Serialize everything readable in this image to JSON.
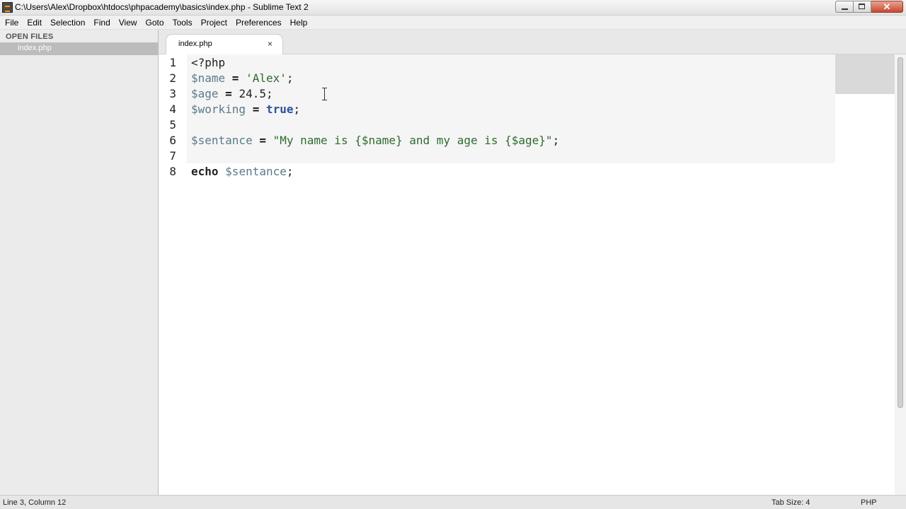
{
  "window": {
    "title": "C:\\Users\\Alex\\Dropbox\\htdocs\\phpacademy\\basics\\index.php - Sublime Text 2",
    "close_glyph": "✕"
  },
  "menu": [
    "File",
    "Edit",
    "Selection",
    "Find",
    "View",
    "Goto",
    "Tools",
    "Project",
    "Preferences",
    "Help"
  ],
  "sidebar": {
    "heading": "OPEN FILES",
    "files": [
      "index.php"
    ]
  },
  "tabs": [
    {
      "label": "index.php",
      "close": "×"
    }
  ],
  "editor": {
    "line_numbers": [
      "1",
      "2",
      "3",
      "4",
      "5",
      "6",
      "7",
      "8"
    ],
    "lines": {
      "l1": {
        "a": "<?php"
      },
      "l2": {
        "var": "$name",
        "op": " = ",
        "str": "'Alex'",
        "end": ";"
      },
      "l3": {
        "var": "$age",
        "op": " = ",
        "num": "24.5",
        "end": ";"
      },
      "l4": {
        "var": "$working",
        "op": " = ",
        "kw": "true",
        "end": ";"
      },
      "l6": {
        "var": "$sentance",
        "op": " = ",
        "str": "\"My name is {$name} and my age is {$age}\"",
        "end": ";"
      },
      "l8": {
        "kw": "echo",
        "sp": " ",
        "var": "$sentance",
        "end": ";"
      }
    }
  },
  "status": {
    "position": "Line 3, Column 12",
    "tab_size": "Tab Size: 4",
    "syntax": "PHP"
  },
  "colors": {
    "sidebar_bg": "#ebebeb",
    "tab_active": "#ffffff",
    "keyword": "#2d4fa0",
    "string": "#2e6b2e"
  }
}
